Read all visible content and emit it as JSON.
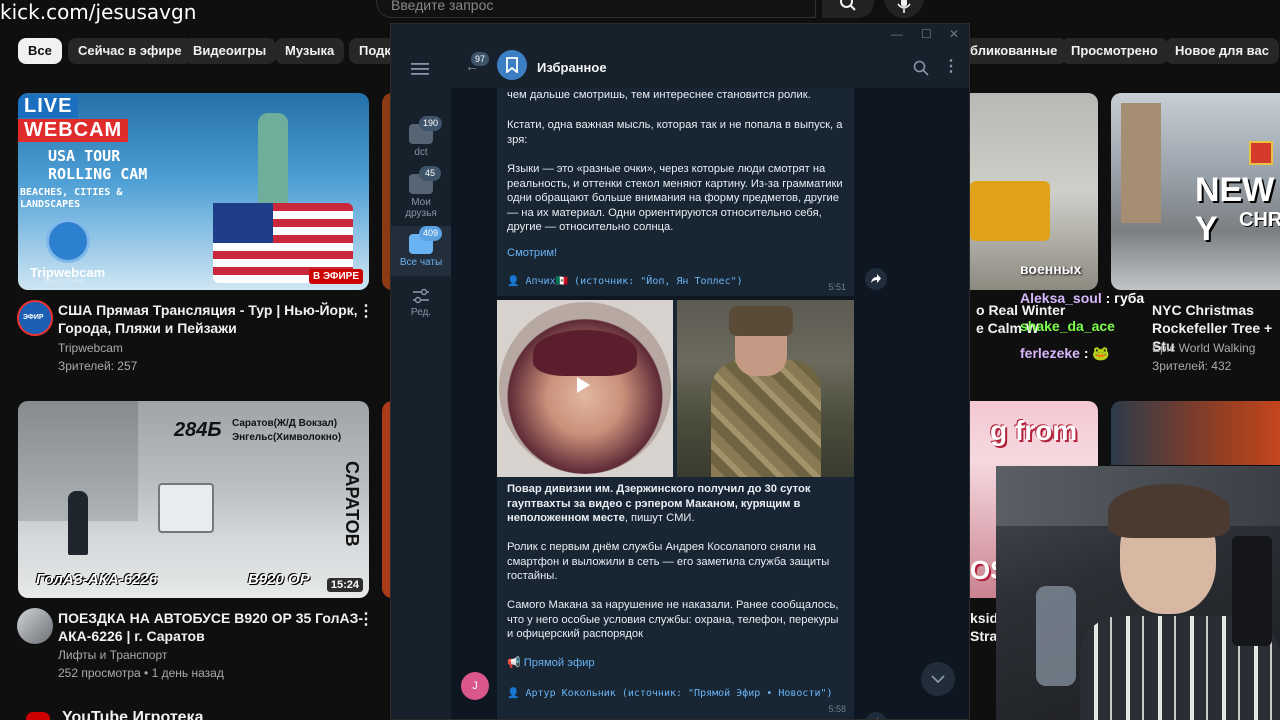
{
  "stream_url": "kick.com/jesusavgn",
  "youtube": {
    "search_placeholder": "Введите запрос",
    "chips": [
      "Все",
      "Сейчас в эфире",
      "Видеоигры",
      "Музыка",
      "Подка",
      "бликованные",
      "Просмотрено",
      "Новое для вас"
    ],
    "videos": [
      {
        "title_line1": "США Прямая Трансляция - Тур | Нью-Йорк,",
        "title_line2": "Города, Пляжи и Пейзажи",
        "channel": "Tripwebcam",
        "meta": "Зрителей: 257",
        "thumb_top": "LIVE",
        "thumb_label": "WEBCAM",
        "thumb_sub1": "USA TOUR",
        "thumb_sub2": "ROLLING CAM",
        "thumb_sub3": "BEACHES, CITIES &",
        "thumb_sub4": "LANDSCAPES",
        "brand": "Tripwebcam",
        "brand_sub": "Eyes on Planet",
        "live_badge": "В ЭФИРЕ",
        "avatar_text": "ЭФИР"
      },
      {
        "title_line1": "ПОЕЗДКА НА АВТОБУСЕ В920 ОР 35 ГолАЗ-",
        "title_line2": "АКА-6226 | г. Саратов",
        "channel": "Лифты и Транспорт",
        "meta": "252 просмотра • 1 день назад",
        "route_num": "284Б",
        "route_text1": "Саратов(Ж/Д Вокзал)",
        "route_text2": "Энгельс(Химволокно)",
        "bus_model": "ГолАЗ-АКА-6226",
        "bus_plate": "В920 ОР",
        "duration": "15:24",
        "side_text": "САРАТОВ"
      },
      {
        "title_line1": "o Real Winter",
        "title_line2": "e Calm W",
        "thumb_label": "военных"
      },
      {
        "title_line1": "NYC Christmas",
        "title_line2": "Rockefeller Tree + Stu",
        "channel": "Epic World Walking",
        "meta": "Зрителей: 432",
        "thumb_text1": "NEW Y",
        "thumb_text2": "CHRIS"
      },
      {
        "thumb_text": "g from",
        "thumb_text2": "OS",
        "title_line1": "ksid",
        "title_line2": "Stra"
      }
    ],
    "section_title": "YouTube Игротека"
  },
  "telegram": {
    "chat_title": "Избранное",
    "back_badge": "97",
    "window_controls": [
      "—",
      "☐",
      "✕"
    ],
    "sidebar": [
      {
        "label": "dct",
        "badge": "190"
      },
      {
        "label_line1": "Мои",
        "label_line2": "друзья",
        "badge": "45"
      },
      {
        "label": "Все чаты",
        "badge": "409"
      },
      {
        "label": "Ред."
      }
    ],
    "message1": {
      "line_top": "чем дальше смотришь, тем интереснее становится ролик.",
      "p1": "Кстати, одна важная мысль, которая так и не попала в выпуск, а зря:",
      "p2": "Языки — это «разные очки», через которые люди смотрят на реальность, и оттенки стекол меняют картину. Из-за грамматики одни обращают больше внимания на форму предметов, другие — на их материал. Одни ориентируются относительно себя, другие — относительно солнца.",
      "link": "Смотрим!",
      "source": "Апчих🇲🇽 (источник: \"Йоп, Ян Топлес\")",
      "time": "5:51"
    },
    "message2": {
      "bold": "Повар дивизии им. Дзержинского получил до 30 суток гауптвахты за видео с рэпером Маканом, курящим в неположенном месте",
      "bold_tail": ", пишут СМИ.",
      "p1": "Ролик с первым днём службы Андрея Косолапого сняли на смартфон и выложили в сеть — его заметила служба защиты гостайны.",
      "p2": "Самого Макана за нарушение не наказали. Ранее сообщалось, что у него особые условия службы: охрана, телефон, перекуры и офицерский распорядок",
      "link": "Прямой эфир",
      "source": "Артур Кокольник (источник: \"Прямой Эфир • Новости\")",
      "time": "5:58"
    },
    "user_initial": "J"
  },
  "stream_chat": [
    {
      "user": "Aleksa_soul",
      "sep": " : ",
      "text": "губа",
      "color": "#d9b8ff"
    },
    {
      "user": "shake_da_ace",
      "sep": "",
      "text": "",
      "color": "#7cff4a"
    },
    {
      "user": "ferlezeke",
      "sep": " : ",
      "text": "🐸",
      "color": "#d9b8ff"
    }
  ]
}
